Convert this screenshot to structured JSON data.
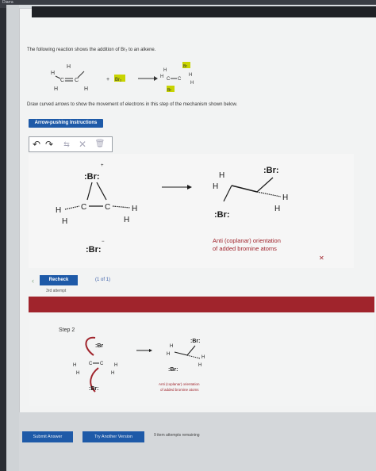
{
  "window": {
    "title": "Diarra"
  },
  "question": {
    "intro": "The following reaction shows the addition of Br₂ to an alkene.",
    "instruction": "Draw curved arrows to show the movement of electrons in this step of the mechanism shown below."
  },
  "buttons": {
    "arrow_pushing": "Arrow-pushing Instructions",
    "recheck": "Recheck",
    "submit": "Submit Answer",
    "try_another": "Try Another Version"
  },
  "status": {
    "attempt": "3rd attempt",
    "pager": "(1 of 1)",
    "remaining": "9 item attempts remaining"
  },
  "mechanism": {
    "br_top": ":Br:",
    "br_bottom": ":Br:",
    "product_br_top": ":Br:",
    "product_br_bottom": ":Br:",
    "h_left": "H",
    "h_left2": "H",
    "h_right": "H",
    "h_right2": "H",
    "c_left": "C",
    "c_right": "C",
    "anti_note": "Anti (coplanar) orientation of added bromine atoms",
    "anti_line1": "Anti (coplanar) orientation",
    "anti_line2": "of added bromine atoms"
  },
  "step2": {
    "label": "Step 2",
    "br_top": ":Br",
    "br_bottom": ":Br:",
    "note_line1": "Anti (coplanar) orientation",
    "note_line2": "of added bromine atoms"
  },
  "reaction": {
    "reagent": "Br₂",
    "h": "H",
    "c": "C",
    "br": "Br"
  },
  "colors": {
    "blue": "#1e5aa8",
    "red": "#a0242c",
    "bromine_top": "#1a1a1a",
    "bromine_bottom": "#1a1a1a",
    "highlight": "#c8d400"
  },
  "icons": [
    "undo-icon",
    "redo-icon",
    "move-icon",
    "delete-x-icon",
    "trash-icon"
  ]
}
